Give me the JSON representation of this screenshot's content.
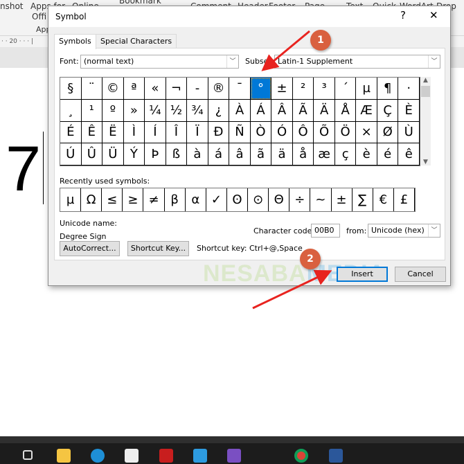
{
  "ribbon": {
    "items": [
      "nshot",
      "Apps for",
      "Offi",
      "App",
      "Online",
      "Bookmark",
      "Comment",
      "Header",
      "Footer",
      "Page",
      "Text",
      "Quick",
      "WordArt",
      "Drop"
    ]
  },
  "ruler": {
    "text": "· · 20 · · · |"
  },
  "document": {
    "text": "7"
  },
  "dialog": {
    "title": "Symbol",
    "help": "?",
    "close": "✕",
    "tabs": [
      {
        "label": "Symbols",
        "active": true
      },
      {
        "label": "Special Characters",
        "active": false
      }
    ],
    "font_label": "Font:",
    "font_value": "(normal text)",
    "subset_label": "Subset:",
    "subset_value": "Latin-1 Supplement",
    "symbols": [
      "§",
      "¨",
      "©",
      "ª",
      "«",
      "¬",
      "-",
      "®",
      "¯",
      "°",
      "±",
      "²",
      "³",
      "´",
      "µ",
      "¶",
      "·",
      "¸",
      "¹",
      "º",
      "»",
      "¼",
      "½",
      "¾",
      "¿",
      "À",
      "Á",
      "Â",
      "Ã",
      "Ä",
      "Å",
      "Æ",
      "Ç",
      "È",
      "É",
      "Ê",
      "Ë",
      "Ì",
      "Í",
      "Î",
      "Ï",
      "Ð",
      "Ñ",
      "Ò",
      "Ó",
      "Ô",
      "Õ",
      "Ö",
      "×",
      "Ø",
      "Ù",
      "Ú",
      "Û",
      "Ü",
      "Ý",
      "Þ",
      "ß",
      "à",
      "á",
      "â",
      "ã",
      "ä",
      "å",
      "æ",
      "ç",
      "è",
      "é",
      "ê"
    ],
    "selected_symbol": "°",
    "recent_label": "Recently used symbols:",
    "recent": [
      "µ",
      "Ω",
      "≤",
      "≥",
      "≠",
      "β",
      "α",
      "✓",
      "ʘ",
      "⊙",
      "Θ",
      "÷",
      "~",
      "±",
      "∑",
      "€",
      "£"
    ],
    "unicode_name_label": "Unicode name:",
    "unicode_name": "Degree Sign",
    "char_code_label": "Character code:",
    "char_code": "00B0",
    "from_label": "from:",
    "from_value": "Unicode (hex)",
    "autocorrect": "AutoCorrect...",
    "shortcut_key_btn": "Shortcut Key...",
    "shortcut_text": "Shortcut key: Ctrl+@,Space",
    "insert": "Insert",
    "cancel": "Cancel"
  },
  "annotations": {
    "step1": "1",
    "step2": "2",
    "watermark_a": "NESABA",
    "watermark_b": "MEDIA",
    "arrow_color": "#e8231f",
    "badge_color": "#d9603f"
  },
  "taskbar": {
    "apps": [
      "task-view",
      "file-explorer",
      "edge",
      "store",
      "gift",
      "mail",
      "visual-studio",
      "chrome",
      "word"
    ]
  }
}
